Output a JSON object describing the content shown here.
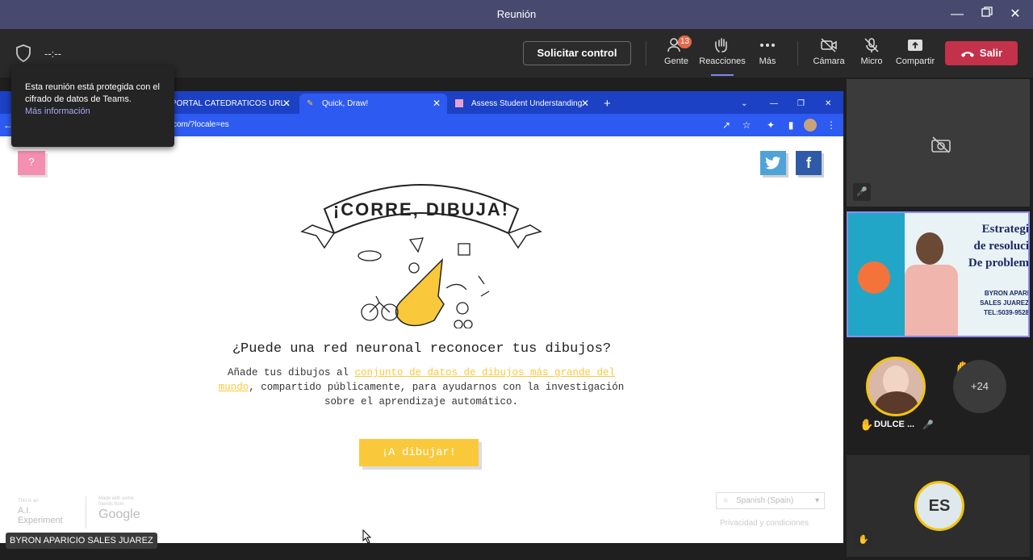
{
  "window": {
    "title": "Reunión"
  },
  "toolbar": {
    "timer": "--:--",
    "request_control": "Solicitar control",
    "people": {
      "label": "Gente",
      "badge": "13"
    },
    "reactions": "Reacciones",
    "more": "Más",
    "camera": "Cámara",
    "mic": "Micro",
    "share": "Compartir",
    "leave": "Salir"
  },
  "tooltip": {
    "text": "Esta reunión está protegida con el cifrado de datos de Teams.",
    "link": "Más información"
  },
  "browser": {
    "tabs": [
      {
        "label": "PORTAL CATEDRATICOS URL :"
      },
      {
        "label": "Quick, Draw!"
      },
      {
        "label": "Assess Student Understanding ·"
      }
    ],
    "url": "com/?locale=es"
  },
  "page": {
    "help": "?",
    "banner": "¡CORRE, DIBUJA!",
    "headline": "¿Puede una red neuronal reconocer tus dibujos?",
    "desc_pre": "Añade tus dibujos al ",
    "desc_link": "conjunto de datos de dibujos más grande del mundo",
    "desc_post": ", compartido públicamente, para ayudarnos con la investigación sobre el aprendizaje automático.",
    "draw_button": "¡A dibujar!",
    "ai_small": "This is an",
    "ai_line1": "A.I.",
    "ai_line2": "Experiment",
    "google_small": "Made with some friends from",
    "google": "Google",
    "language": "Spanish (Spain)",
    "privacy": "Privacidad y condiciones"
  },
  "presenter": {
    "name": "BYRON APARICIO SALES JUAREZ"
  },
  "participants": {
    "slide_text1": "Estrategi",
    "slide_text2": "de resoluci",
    "slide_text3": "De problem",
    "slide_small1": "BYRON APARI",
    "slide_small2": "SALES JUAREZ",
    "slide_small3": "TEL:5039-9528",
    "dulce": "DULCE ...",
    "more_count": "+24",
    "es_initials": "ES"
  }
}
